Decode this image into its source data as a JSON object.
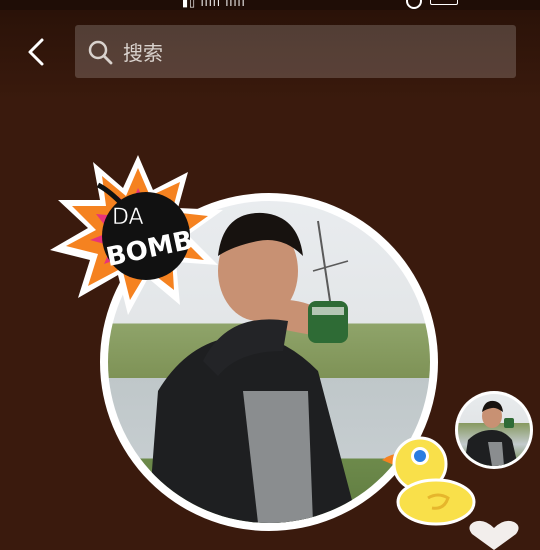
{
  "search": {
    "placeholder": "搜索"
  },
  "icons": {
    "back": "chevron-left-icon",
    "search": "search-icon",
    "like": "heart-icon"
  },
  "stickers": {
    "bomb_text_line1": "DA",
    "bomb_text_line2": "BOMB"
  },
  "colors": {
    "background": "#3a1a0d",
    "search_bg": "rgba(255,255,255,0.18)",
    "sticker_orange": "#f58220",
    "sticker_pink": "#e8337a",
    "duck_yellow": "#f9e04a"
  }
}
